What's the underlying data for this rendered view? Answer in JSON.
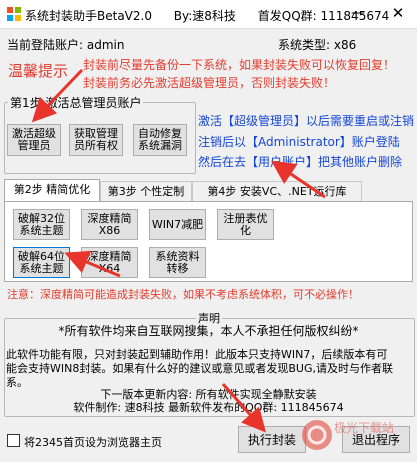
{
  "window": {
    "title": "系统封装助手BetaV2.0",
    "author": "By:速8科技",
    "qq_group": "首发QQ群: 111845674",
    "minimize_glyph": "—",
    "close_glyph": "✕"
  },
  "status": {
    "user_label": "当前登陆账户: admin",
    "system_label": "系统类型: x86"
  },
  "warning": {
    "title": "温馨提示",
    "line1": "封装前尽量先备份一下系统，如果封装失败可以恢复回复！",
    "line2": "封装前务必先激活超级管理员，否则封装失败！"
  },
  "step1": {
    "caption": "第1步 激活总管理员账户",
    "buttons": [
      "激活超级\n管理员",
      "获取管理\n员所有权",
      "自动修复\n系统漏洞"
    ],
    "note1": "激活【超级管理员】以后需要重启或注销",
    "note2": "注销后以【Administrator】账户登陆",
    "note3": "然后在去【用户账户】把其他账户删除"
  },
  "tabs": [
    "第2步 精简优化",
    "第3步 个性定制",
    "第4步 安装VC、.NET运行库"
  ],
  "step2": {
    "buttons": [
      "破解32位\n系统主题",
      "深度精简\nX86",
      "WIN7减肥",
      "注册表优\n化",
      "破解64位\n系统主题",
      "深度精简\nX64",
      "系统资料\n转移"
    ]
  },
  "notice": "注意：深度精简可能造成封装失败，如果不考虑系统体积，可不必操作！",
  "declaration": {
    "caption": "声明",
    "line1": "*所有软件均来自互联网搜集，本人不承担任何版权纠纷*",
    "line2": "此软件功能有限，只对封装起到辅助作用！此版本只支持WIN7，后续版本有可",
    "line3": "能会支持WIN8封装。如果有什么好的建议或意见或者发现BUG,请及时与作者联",
    "line4": "系。",
    "line5": "下一版本更新内容: 所有软件实现全静默安装",
    "line6": "软件制作: 速8科技     最新软件发布的QQ群: 111845674"
  },
  "footer": {
    "checkbox_label": "将2345首页设为浏览器主页",
    "checkbox_checked": false,
    "run_button": "执行封装",
    "exit_button": "退出程序"
  },
  "watermark": "极光下载站",
  "colors": {
    "warning_red": "#e23c2f",
    "note_blue": "#1547d6",
    "arrow_red": "#e8342a"
  }
}
